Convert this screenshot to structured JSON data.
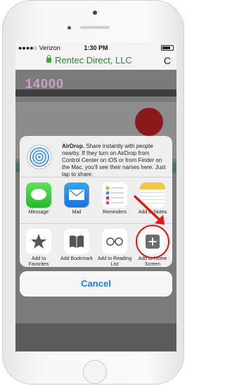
{
  "status": {
    "carrier": "●●●●○ Verizon",
    "time": "1:30 PM"
  },
  "browser": {
    "host": "Rentec Direct, LLC",
    "reload": "C"
  },
  "page": {
    "logo": "14000"
  },
  "airdrop": {
    "title": "AirDrop.",
    "text": "Share instantly with people nearby. If they turn on AirDrop from Control Center on iOS or from Finder on the Mac, you'll see their names here. Just tap to share."
  },
  "apps": [
    {
      "label": "Message",
      "icon": "message-icon"
    },
    {
      "label": "Mail",
      "icon": "mail-icon"
    },
    {
      "label": "Reminders",
      "icon": "reminders-icon"
    },
    {
      "label": "Add to Notes",
      "icon": "notes-icon"
    }
  ],
  "actions": [
    {
      "label": "Add to Favorites",
      "icon": "star-icon"
    },
    {
      "label": "Add Bookmark",
      "icon": "book-icon"
    },
    {
      "label": "Add to Reading List",
      "icon": "glasses-icon"
    },
    {
      "label": "Add to Home Screen",
      "icon": "plus-square-icon"
    }
  ],
  "cancel_label": "Cancel",
  "colors": {
    "accent": "#1c7ef3",
    "highlight": "#e01818"
  }
}
